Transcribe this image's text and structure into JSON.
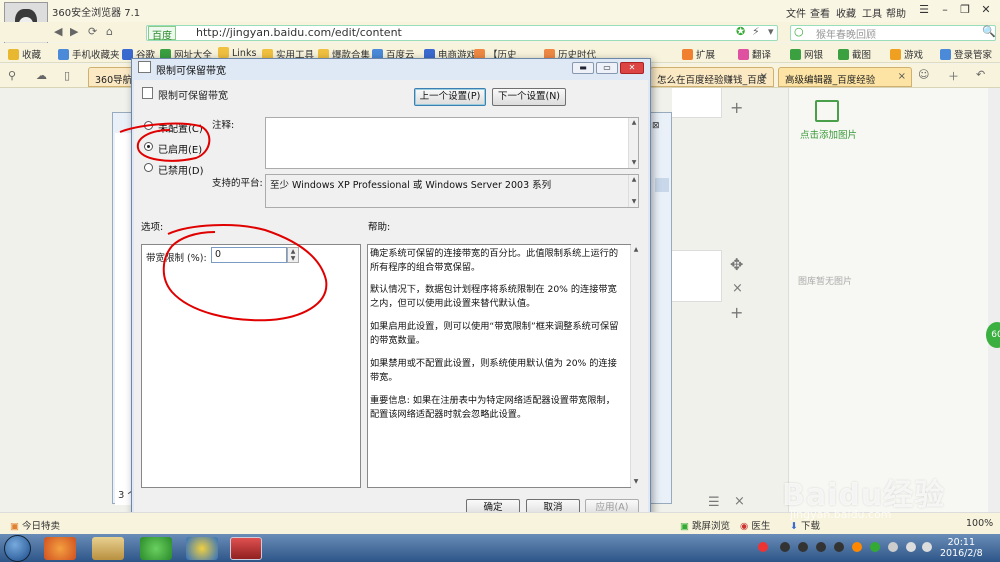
{
  "browser": {
    "title": "360安全浏览器 7.1",
    "menu": [
      "文件",
      "查看",
      "收藏",
      "工具",
      "帮助"
    ],
    "address": {
      "engine": "百度",
      "url": "http://jingyan.baidu.com/edit/content"
    },
    "search_placeholder": "猴年春晚回顾",
    "favorites": [
      "收藏",
      "手机收藏夹",
      "谷歌",
      "网址大全",
      "Links",
      "实用工具",
      "爆款合集",
      "百度云",
      "电商游戏",
      "【历史",
      "历史时代",
      "扩展",
      "翻译",
      "网银",
      "截图",
      "游戏",
      "登录管家"
    ],
    "tabs": [
      {
        "label": "360导航"
      },
      {
        "label": "怎么在百度经验赚钱_百度"
      },
      {
        "label": "高级编辑器_百度经验"
      }
    ]
  },
  "page": {
    "add_image_label": "点击添加图片",
    "no_image_label": "图库暂无图片",
    "bg_window_count": "3 个"
  },
  "dialog": {
    "title": "限制可保留带宽",
    "policy_name": "限制可保留带宽",
    "prev_button": "上一个设置(P)",
    "next_button": "下一个设置(N)",
    "radios": [
      {
        "label": "未配置(C)",
        "checked": false
      },
      {
        "label": "已启用(E)",
        "checked": true
      },
      {
        "label": "已禁用(D)",
        "checked": false
      }
    ],
    "comment_label": "注释:",
    "platform_label": "支持的平台:",
    "platform_text": "至少 Windows XP Professional 或 Windows Server 2003 系列",
    "options_label": "选项:",
    "help_label": "帮助:",
    "bandwidth_label": "带宽限制 (%):",
    "bandwidth_value": "0",
    "help_paragraphs": [
      "确定系统可保留的连接带宽的百分比。此值限制系统上运行的所有程序的组合带宽保留。",
      "默认情况下，数据包计划程序将系统限制在 20% 的连接带宽之内，但可以使用此设置来替代默认值。",
      "如果启用此设置，则可以使用“带宽限制”框来调整系统可保留的带宽数量。",
      "如果禁用或不配置此设置，则系统使用默认值为 20% 的连接带宽。",
      "重要信息: 如果在注册表中为特定网络适配器设置带宽限制，配置该网络适配器时就会忽略此设置。"
    ],
    "ok_button": "确定",
    "cancel_button": "取消",
    "apply_button": "应用(A)"
  },
  "statusbar": {
    "left": "今日特卖",
    "items": [
      "跳屏浏览",
      "医生",
      "下载",
      "100%"
    ]
  },
  "taskbar": {
    "time": "20:11",
    "date": "2016/2/8"
  },
  "watermark": {
    "main": "Baidu经验",
    "sub": "jingyan.baidu.com"
  },
  "colors": {
    "annotation": "#e00000",
    "dialog_frame": "#dfe9f5",
    "browser_chrome": "#f7f3dc"
  }
}
